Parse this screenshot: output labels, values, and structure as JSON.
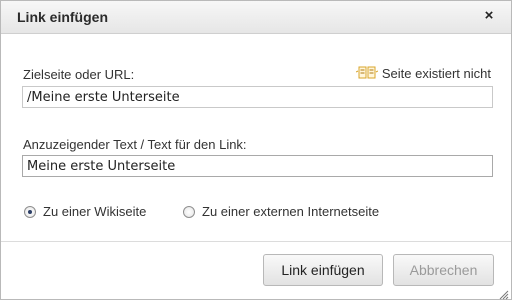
{
  "dialog": {
    "title": "Link einfügen",
    "close_glyph": "×",
    "close_icon": "close-icon"
  },
  "target": {
    "label": "Zielseite oder URL:",
    "value": "/Meine erste Unterseite",
    "status_icon": "page-missing-icon",
    "status_text": "Seite existiert nicht"
  },
  "link_text": {
    "label": "Anzuzeigender Text / Text für den Link:",
    "value": "Meine erste Unterseite"
  },
  "link_type": {
    "options": [
      {
        "label": "Zu einer Wikiseite",
        "checked": true
      },
      {
        "label": "Zu einer externen Internetseite",
        "checked": false
      }
    ]
  },
  "buttons": {
    "insert_label": "Link einfügen",
    "cancel_label": "Abbrechen"
  },
  "colors": {
    "titlebar": "#ececec",
    "disabled_text": "#9a9a9a",
    "status_icon": "#d9a52a"
  }
}
